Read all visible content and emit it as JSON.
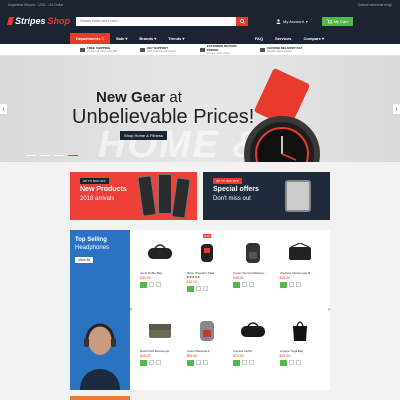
{
  "topbar": {
    "left": "Argentina Stripes  ·  USD - US Dollar",
    "right": "Default welcome msg!"
  },
  "header": {
    "logo_main": "Stripes",
    "logo_accent": "Shop",
    "search_placeholder": "Search entire store here...",
    "account_label": "My Account",
    "cart_label": "My Cart"
  },
  "nav": {
    "departments": "Departments",
    "items": [
      "Sale",
      "Brands",
      "Trends"
    ],
    "right_items": [
      "FAQ",
      "Services",
      "Compare"
    ]
  },
  "features": [
    {
      "title": "FREE SHIPPING",
      "sub": "Free for all orders over $90"
    },
    {
      "title": "24/7 SUPPORT",
      "sub": "Fast, professional support"
    },
    {
      "title": "EXTENDED RETURN PERIOD",
      "sub": "30 days return policy"
    },
    {
      "title": "CHOOSE DELIVERY DAY",
      "sub": "Flexible delivery dates"
    }
  ],
  "hero": {
    "line1_bold": "New Gear",
    "line1_thin": "at",
    "line2": "Unbelievable Prices!",
    "button": "Shop Home & Fitness",
    "ghost": "HOME & FITNESS"
  },
  "promos": [
    {
      "tag": "UP TO 50% OFF",
      "title": "New Products",
      "sub": "2018 arrivals"
    },
    {
      "tag": "UP TO 60% OFF",
      "title": "Special offers",
      "sub": "Don't miss out"
    }
  ],
  "top_selling": {
    "title": "Top Selling",
    "subtitle": "Headphones",
    "button": "View All"
  },
  "products": [
    {
      "name": "Joust Duffle Bag",
      "price": "$34.00",
      "sale": ""
    },
    {
      "name": "Strive Shoulder Pack",
      "price": "$32.00",
      "sale": "SALE",
      "stars": "★★★★★"
    },
    {
      "name": "Crown Summit Backpa...",
      "price": "$38.00",
      "sale": ""
    },
    {
      "name": "Wayfarer Messenger B...",
      "price": "$45.00",
      "sale": ""
    },
    {
      "name": "Rival Field Messenger",
      "price": "$45.00",
      "sale": ""
    },
    {
      "name": "Fusion Backpack",
      "price": "$59.00",
      "sale": ""
    },
    {
      "name": "Impulse Duffle",
      "price": "$74.00",
      "sale": ""
    },
    {
      "name": "Voyage Yoga Bag",
      "price": "$32.00",
      "sale": ""
    }
  ],
  "colors": {
    "accent": "#e83b2e",
    "dark": "#1d2431",
    "green": "#55b74e",
    "blue": "#2a72c2"
  }
}
